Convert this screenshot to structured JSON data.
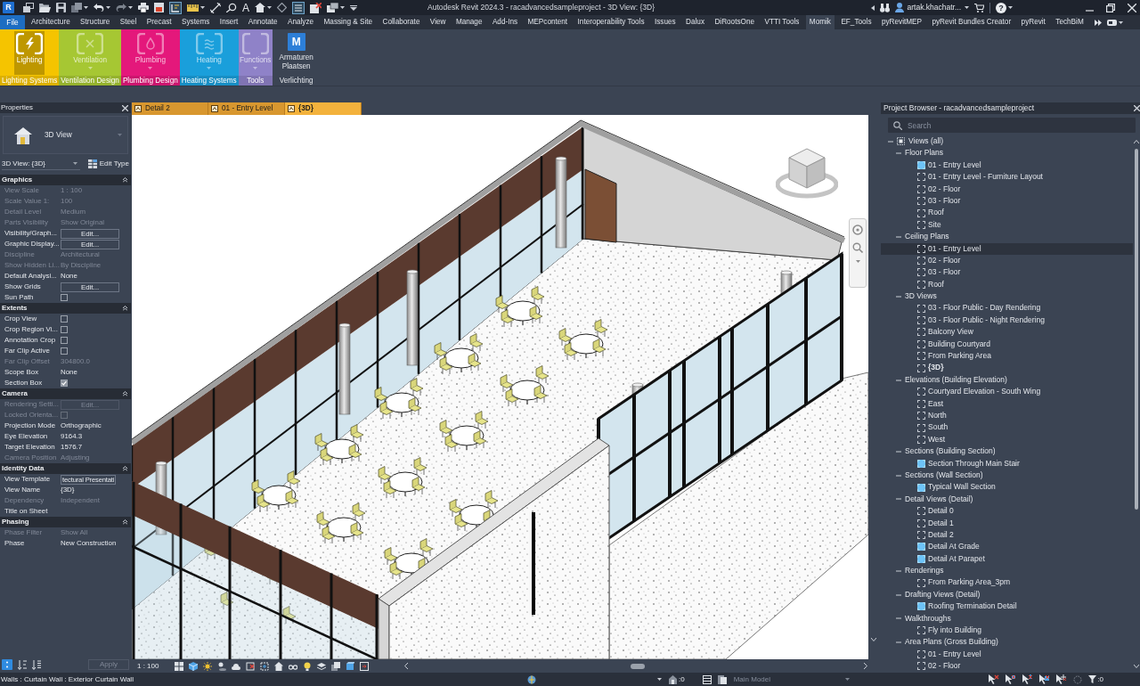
{
  "title_bar": {
    "app_logo": "R",
    "text_tool": "A",
    "title": "Autodesk Revit 2024.3 - racadvancedsampleproject - 3D View: {3D}",
    "user": "artak.khachatr...",
    "help": "?"
  },
  "ribbon": {
    "file_menu": "File",
    "tabs": [
      {
        "label": "Architecture",
        "selected": false
      },
      {
        "label": "Structure",
        "selected": false
      },
      {
        "label": "Steel",
        "selected": false
      },
      {
        "label": "Precast",
        "selected": false
      },
      {
        "label": "Systems",
        "selected": false
      },
      {
        "label": "Insert",
        "selected": false
      },
      {
        "label": "Annotate",
        "selected": false
      },
      {
        "label": "Analyze",
        "selected": false
      },
      {
        "label": "Massing & Site",
        "selected": false
      },
      {
        "label": "Collaborate",
        "selected": false
      },
      {
        "label": "View",
        "selected": false
      },
      {
        "label": "Manage",
        "selected": false
      },
      {
        "label": "Add-Ins",
        "selected": false
      },
      {
        "label": "MEPcontent",
        "selected": false
      },
      {
        "label": "Interoperability Tools",
        "selected": false
      },
      {
        "label": "Issues",
        "selected": false
      },
      {
        "label": "Dalux",
        "selected": false
      },
      {
        "label": "DiRootsOne",
        "selected": false
      },
      {
        "label": "VTTI Tools",
        "selected": false
      },
      {
        "label": "Momik",
        "selected": true
      },
      {
        "label": "EF_Tools",
        "selected": false
      },
      {
        "label": "pyRevitMEP",
        "selected": false
      },
      {
        "label": "pyRevit Bundles Creator",
        "selected": false
      },
      {
        "label": "pyRevit",
        "selected": false
      },
      {
        "label": "TechBiM",
        "selected": false
      }
    ],
    "panels": [
      {
        "title": "Lighting Systems",
        "color": "#f5c400",
        "button": {
          "label": "Lighting",
          "disabled": false,
          "highlighted": true,
          "dropdown": false
        }
      },
      {
        "title": "Ventilation Design",
        "color": "#a6c733",
        "button": {
          "label": "Ventilation",
          "disabled": true,
          "highlighted": false,
          "dropdown": true
        }
      },
      {
        "title": "Plumbing Design",
        "color": "#e4187b",
        "button": {
          "label": "Plumbing",
          "disabled": true,
          "highlighted": false,
          "dropdown": true
        }
      },
      {
        "title": "Heating Systems",
        "color": "#1a9fdb",
        "button": {
          "label": "Heating",
          "disabled": true,
          "highlighted": false,
          "dropdown": true
        }
      },
      {
        "title": "Tools",
        "color": "#8f82c8",
        "button": {
          "label": "Functions",
          "disabled": true,
          "highlighted": false,
          "dropdown": true
        }
      },
      {
        "title": "Verlichting",
        "button": {
          "label": "Armaturen Plaatsen",
          "icon_letter": "M",
          "disabled": false,
          "highlighted": false,
          "dropdown": false
        }
      }
    ]
  },
  "view_tabs": [
    {
      "label": "Detail 2",
      "selected": false
    },
    {
      "label": "01 - Entry Level",
      "selected": false
    },
    {
      "label": "{3D}",
      "selected": true
    }
  ],
  "properties": {
    "title": "Properties",
    "type_name": "3D View",
    "instance": "3D View: {3D}",
    "edit_type": "Edit Type",
    "groups": [
      {
        "name": "Graphics",
        "expanded": true,
        "rows": [
          {
            "label": "View Scale",
            "kind": "text",
            "value": "1 : 100",
            "disabled": true
          },
          {
            "label": "Scale Value 1:",
            "kind": "text",
            "value": "100",
            "disabled": true
          },
          {
            "label": "Detail Level",
            "kind": "text",
            "value": "Medium",
            "disabled": true
          },
          {
            "label": "Parts Visibility",
            "kind": "text",
            "value": "Show Original",
            "disabled": true
          },
          {
            "label": "Visibility/Graph...",
            "kind": "button",
            "value": "Edit...",
            "disabled": false
          },
          {
            "label": "Graphic Display...",
            "kind": "button",
            "value": "Edit...",
            "disabled": false
          },
          {
            "label": "Discipline",
            "kind": "text",
            "value": "Architectural",
            "disabled": true
          },
          {
            "label": "Show Hidden Li...",
            "kind": "text",
            "value": "By Discipline",
            "disabled": true
          },
          {
            "label": "Default Analysi...",
            "kind": "text",
            "value": "None",
            "disabled": false
          },
          {
            "label": "Show Grids",
            "kind": "button",
            "value": "Edit...",
            "disabled": false
          },
          {
            "label": "Sun Path",
            "kind": "checkbox",
            "checked": false,
            "disabled": false
          }
        ]
      },
      {
        "name": "Extents",
        "expanded": true,
        "rows": [
          {
            "label": "Crop View",
            "kind": "checkbox",
            "checked": false,
            "disabled": false
          },
          {
            "label": "Crop Region Vi...",
            "kind": "checkbox",
            "checked": false,
            "disabled": false
          },
          {
            "label": "Annotation Crop",
            "kind": "checkbox",
            "checked": false,
            "disabled": false
          },
          {
            "label": "Far Clip Active",
            "kind": "checkbox",
            "checked": false,
            "disabled": false
          },
          {
            "label": "Far Clip Offset",
            "kind": "text",
            "value": "304800.0",
            "disabled": true
          },
          {
            "label": "Scope Box",
            "kind": "text",
            "value": "None",
            "disabled": false
          },
          {
            "label": "Section Box",
            "kind": "checkbox",
            "checked": true,
            "disabled": false
          }
        ]
      },
      {
        "name": "Camera",
        "expanded": true,
        "rows": [
          {
            "label": "Rendering Setti...",
            "kind": "button",
            "value": "Edit...",
            "disabled": true
          },
          {
            "label": "Locked Orienta...",
            "kind": "checkbox",
            "checked": false,
            "disabled": true
          },
          {
            "label": "Projection Mode",
            "kind": "text",
            "value": "Orthographic",
            "disabled": false
          },
          {
            "label": "Eye Elevation",
            "kind": "text",
            "value": "9164.3",
            "disabled": false
          },
          {
            "label": "Target Elevation",
            "kind": "text",
            "value": "1576.7",
            "disabled": false
          },
          {
            "label": "Camera Position",
            "kind": "text",
            "value": "Adjusting",
            "disabled": true
          }
        ]
      },
      {
        "name": "Identity Data",
        "expanded": true,
        "rows": [
          {
            "label": "View Template",
            "kind": "field",
            "value": "tectural Presentati",
            "disabled": false
          },
          {
            "label": "View Name",
            "kind": "text",
            "value": "{3D}",
            "disabled": false
          },
          {
            "label": "Dependency",
            "kind": "text",
            "value": "Independent",
            "disabled": true
          },
          {
            "label": "Title on Sheet",
            "kind": "text",
            "disabled": false
          }
        ]
      },
      {
        "name": "Phasing",
        "expanded": true,
        "rows": [
          {
            "label": "Phase Filter",
            "kind": "text",
            "value": "Show All",
            "disabled": true
          },
          {
            "label": "Phase",
            "kind": "text",
            "value": "New Construction",
            "disabled": false
          }
        ]
      }
    ],
    "apply": "Apply"
  },
  "project_browser": {
    "title": "Project Browser - racadvancedsampleproject",
    "search_placeholder": "Search",
    "tree": [
      {
        "label": "Views (all)",
        "expanded": true,
        "selected": false,
        "children": [
          {
            "label": "Floor Plans",
            "expanded": true,
            "selected": false,
            "children": [
              {
                "label": "01 - Entry Level",
                "on_sheet": true,
                "selected": false,
                "active": false
              },
              {
                "label": "01 - Entry Level - Furniture Layout",
                "on_sheet": false,
                "selected": false,
                "active": false
              },
              {
                "label": "02 - Floor",
                "on_sheet": false,
                "selected": false,
                "active": false
              },
              {
                "label": "03 - Floor",
                "on_sheet": false,
                "selected": false,
                "active": false
              },
              {
                "label": "Roof",
                "on_sheet": false,
                "selected": false,
                "active": false
              },
              {
                "label": "Site",
                "on_sheet": false,
                "selected": false,
                "active": false
              }
            ]
          },
          {
            "label": "Ceiling Plans",
            "expanded": true,
            "selected": false,
            "children": [
              {
                "label": "01 - Entry Level",
                "on_sheet": false,
                "selected": true,
                "active": false
              },
              {
                "label": "02 - Floor",
                "on_sheet": false,
                "selected": false,
                "active": false
              },
              {
                "label": "03 - Floor",
                "on_sheet": false,
                "selected": false,
                "active": false
              },
              {
                "label": "Roof",
                "on_sheet": false,
                "selected": false,
                "active": false
              }
            ]
          },
          {
            "label": "3D Views",
            "expanded": true,
            "selected": false,
            "children": [
              {
                "label": "03 - Floor Public - Day Rendering",
                "on_sheet": false,
                "selected": false,
                "active": false
              },
              {
                "label": "03 - Floor Public - Night Rendering",
                "on_sheet": false,
                "selected": false,
                "active": false
              },
              {
                "label": "Balcony View",
                "on_sheet": false,
                "selected": false,
                "active": false
              },
              {
                "label": "Building Courtyard",
                "on_sheet": false,
                "selected": false,
                "active": false
              },
              {
                "label": "From Parking Area",
                "on_sheet": false,
                "selected": false,
                "active": false
              },
              {
                "label": "{3D}",
                "on_sheet": false,
                "selected": false,
                "active": true
              }
            ]
          },
          {
            "label": "Elevations (Building Elevation)",
            "expanded": true,
            "selected": false,
            "children": [
              {
                "label": "Courtyard Elevation - South Wing",
                "on_sheet": false,
                "selected": false,
                "active": false
              },
              {
                "label": "East",
                "on_sheet": false,
                "selected": false,
                "active": false
              },
              {
                "label": "North",
                "on_sheet": false,
                "selected": false,
                "active": false
              },
              {
                "label": "South",
                "on_sheet": false,
                "selected": false,
                "active": false
              },
              {
                "label": "West",
                "on_sheet": false,
                "selected": false,
                "active": false
              }
            ]
          },
          {
            "label": "Sections (Building Section)",
            "expanded": true,
            "selected": false,
            "children": [
              {
                "label": "Section Through Main Stair",
                "on_sheet": true,
                "selected": false,
                "active": false
              }
            ]
          },
          {
            "label": "Sections (Wall Section)",
            "expanded": true,
            "selected": false,
            "children": [
              {
                "label": "Typical Wall Section",
                "on_sheet": true,
                "selected": false,
                "active": false
              }
            ]
          },
          {
            "label": "Detail Views (Detail)",
            "expanded": true,
            "selected": false,
            "children": [
              {
                "label": "Detail 0",
                "on_sheet": false,
                "selected": false,
                "active": false
              },
              {
                "label": "Detail 1",
                "on_sheet": false,
                "selected": false,
                "active": false
              },
              {
                "label": "Detail 2",
                "on_sheet": false,
                "selected": false,
                "active": false
              },
              {
                "label": "Detail At Grade",
                "on_sheet": true,
                "selected": false,
                "active": false
              },
              {
                "label": "Detail At Parapet",
                "on_sheet": true,
                "selected": false,
                "active": false
              }
            ]
          },
          {
            "label": "Renderings",
            "expanded": true,
            "selected": false,
            "children": [
              {
                "label": "From Parking Area_3pm",
                "on_sheet": false,
                "selected": false,
                "active": false
              }
            ]
          },
          {
            "label": "Drafting Views (Detail)",
            "expanded": true,
            "selected": false,
            "children": [
              {
                "label": "Roofing Termination Detail",
                "on_sheet": true,
                "selected": false,
                "active": false
              }
            ]
          },
          {
            "label": "Walkthroughs",
            "expanded": true,
            "selected": false,
            "children": [
              {
                "label": "Fly into Building",
                "on_sheet": false,
                "selected": false,
                "active": false
              }
            ]
          },
          {
            "label": "Area Plans (Gross Building)",
            "expanded": true,
            "selected": false,
            "children": [
              {
                "label": "01 - Entry Level",
                "on_sheet": false,
                "selected": false,
                "active": false
              },
              {
                "label": "02 - Floor",
                "on_sheet": false,
                "selected": false,
                "active": false
              }
            ]
          }
        ]
      }
    ]
  },
  "view_control_bar": {
    "scale": "1 : 100"
  },
  "status_bar": {
    "selection": "Walls : Curtain Wall : Exterior Curtain Wall",
    "editable_count": ":0",
    "active_model": "Main Model",
    "filter_count": ":0"
  }
}
